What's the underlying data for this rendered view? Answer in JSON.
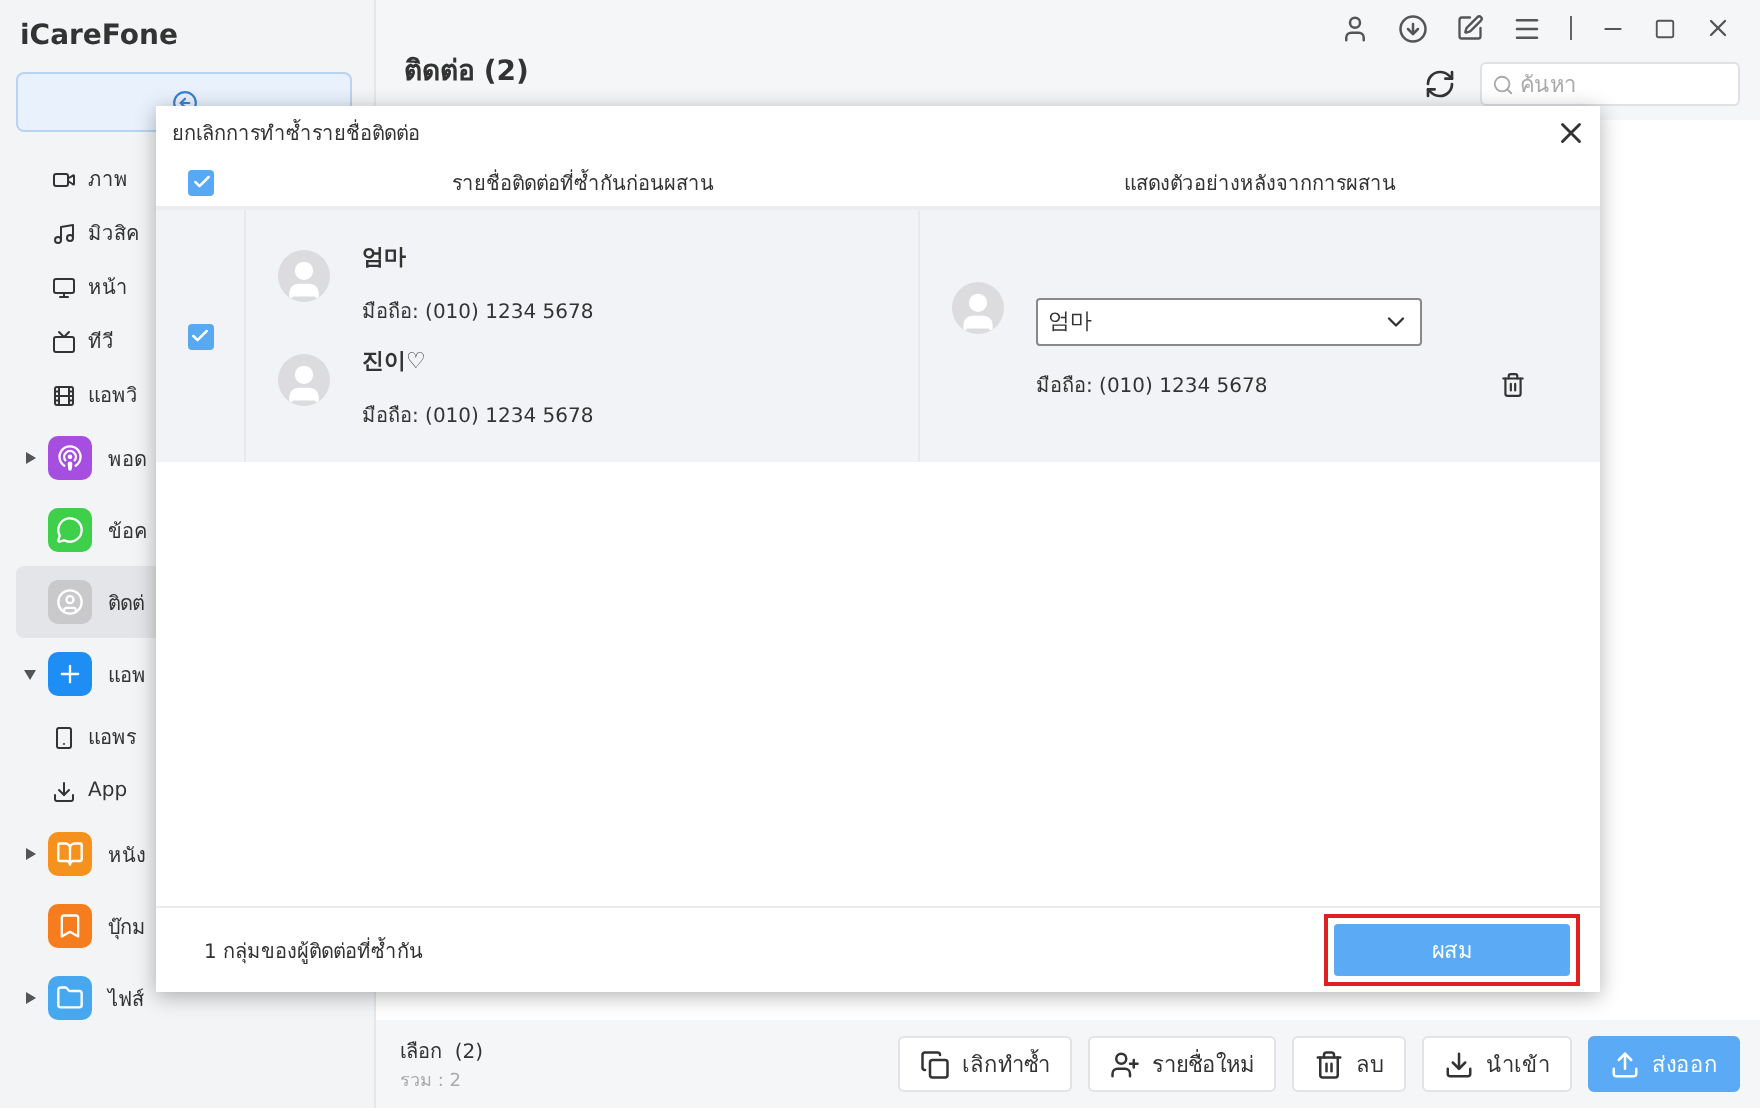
{
  "app": {
    "title": "iCareFone"
  },
  "sidebar": {
    "items": [
      {
        "kind": "sub",
        "label": "ภาพ",
        "selected": false
      },
      {
        "kind": "sub",
        "label": "มิวสิค",
        "selected": false
      },
      {
        "kind": "sub",
        "label": "หน้า",
        "selected": false
      },
      {
        "kind": "sub",
        "label": "ทีวี",
        "selected": false
      },
      {
        "kind": "sub",
        "label": "แอพวิ",
        "selected": false
      },
      {
        "kind": "app",
        "label": "พอด",
        "selected": false,
        "expanded": false
      },
      {
        "kind": "app",
        "label": "ข้อค",
        "selected": false
      },
      {
        "kind": "app",
        "label": "ติดต่",
        "selected": true
      },
      {
        "kind": "app",
        "label": "แอพ",
        "selected": false,
        "expanded": true
      },
      {
        "kind": "sub",
        "label": "แอพร",
        "selected": false
      },
      {
        "kind": "sub",
        "label": "App",
        "selected": false
      },
      {
        "kind": "app",
        "label": "หนัง",
        "selected": false,
        "expanded": false
      },
      {
        "kind": "app",
        "label": "บุ๊กม",
        "selected": false
      },
      {
        "kind": "app",
        "label": "ไฟส์",
        "selected": false,
        "expanded": false
      }
    ]
  },
  "header": {
    "title": "ติดต่อ (2)",
    "search": {
      "placeholder": "ค้นหา"
    }
  },
  "dialog": {
    "title": "ยกเลิกการทำซ้ำรายชื่อติดต่อ",
    "select_all": {
      "checked": true
    },
    "columns": [
      "รายชื่อติดต่อที่ซ้ำกันก่อนผสาน",
      "แสดงตัวอย่างหลังจากการผสาน"
    ],
    "groups": [
      {
        "checked": true,
        "contacts": [
          {
            "name": "엄마",
            "phone": "มือถือ: (010) 1234 5678"
          },
          {
            "name": "진이♡",
            "phone": "มือถือ: (010) 1234 5678"
          }
        ],
        "preview": {
          "name": "엄마",
          "phone": "มือถือ: (010) 1234 5678"
        }
      }
    ],
    "summary": "1 กลุ่มของผู้ติดต่อที่ซ้ำกัน",
    "merge_button": "ผสม"
  },
  "footer": {
    "selected": "เลือก  (2)",
    "total": "รวม : 2",
    "buttons": [
      {
        "label": "เลิกทำซ้ำ",
        "primary": false
      },
      {
        "label": "รายชื่อใหม่",
        "primary": false
      },
      {
        "label": "ลบ",
        "primary": false
      },
      {
        "label": "นำเข้า",
        "primary": false
      },
      {
        "label": "ส่งออก",
        "primary": true
      }
    ]
  }
}
